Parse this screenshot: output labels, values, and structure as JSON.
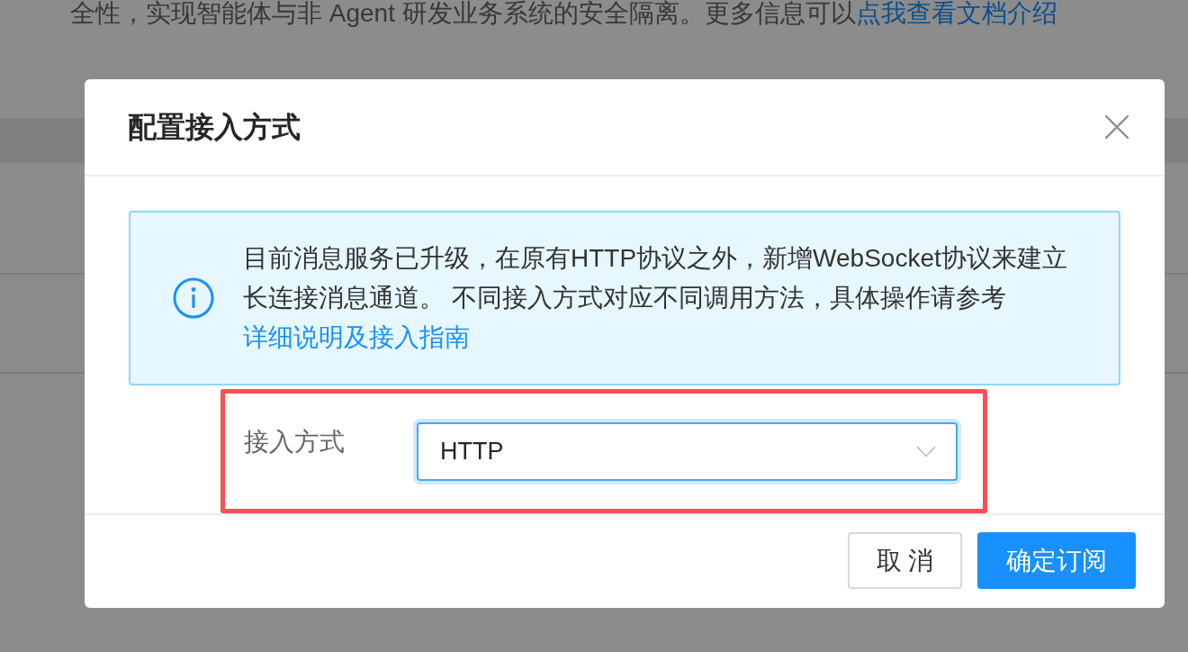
{
  "background": {
    "notice": {
      "text": "全性，实现智能体与非 Agent 研发业务系统的安全隔离。更多信息可以",
      "link": "点我查看文档介绍"
    }
  },
  "dialog": {
    "title": "配置接入方式",
    "alert": {
      "text": "目前消息服务已升级，在原有HTTP协议之外，新增WebSocket协议来建立长连接消息通道。 不同接入方式对应不同调用方法，具体操作请参考",
      "link": "详细说明及接入指南"
    },
    "field": {
      "label": "接入方式",
      "value": "HTTP",
      "focused": true,
      "highlighted": true
    },
    "buttons": [
      {
        "label": "取 消",
        "kind": "default"
      },
      {
        "label": "确定订阅",
        "kind": "primary"
      }
    ]
  }
}
